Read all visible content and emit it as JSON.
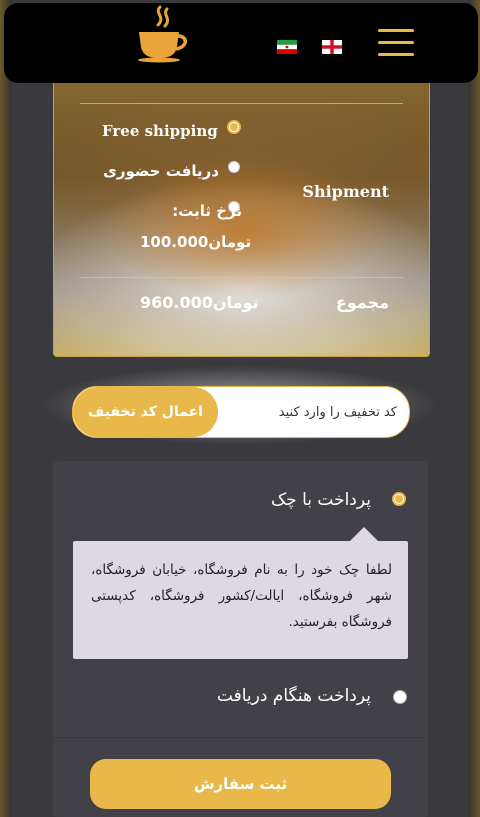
{
  "header": {
    "logo_icon": "coffee-cup-logo-icon",
    "flags": [
      "iran-flag-icon",
      "england-flag-icon"
    ],
    "menu_icon": "hamburger-menu-icon"
  },
  "totals": {
    "shipment_label": "Shipment",
    "shipping_options": [
      {
        "label": "Free shipping",
        "checked": true
      },
      {
        "label": "دریافت حضوری",
        "checked": false
      },
      {
        "label": "نرخ ثابت:",
        "price": "100.000تومان",
        "checked": false
      }
    ],
    "total_label": "مجموع",
    "total_value": "960.000تومان"
  },
  "coupon": {
    "placeholder": "کد تخفیف را وارد کنید",
    "apply_label": "اعمال کد تخفیف"
  },
  "payment": {
    "options": [
      {
        "label": "پرداخت با چک",
        "checked": true
      },
      {
        "label": "پرداخت هنگام دریافت",
        "checked": false
      }
    ],
    "cheque_note": "لطفا چک خود را به نام فروشگاه، خیابان فروشگاه، شهر فروشگاه، ایالت/کشور فروشگاه، کدپستی فروشگاه بفرستید.",
    "submit_label": "ثبت سفارش"
  },
  "colors": {
    "accent": "#e8b94a",
    "header_bg": "#000000",
    "panel_bg": "#434148"
  }
}
